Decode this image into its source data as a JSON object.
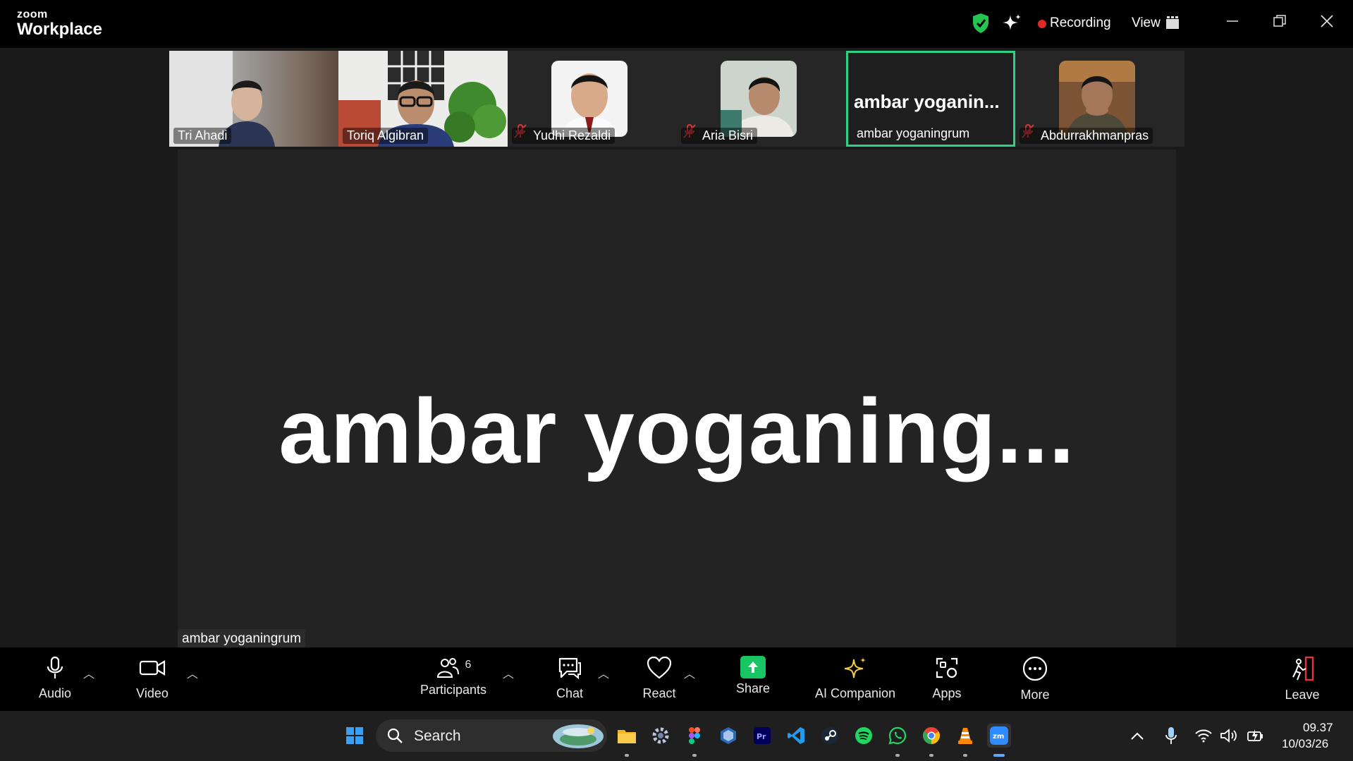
{
  "app": {
    "brand_small": "zoom",
    "brand_big": "Workplace"
  },
  "header": {
    "recording_label": "Recording",
    "view_label": "View"
  },
  "thumbnails": [
    {
      "name": "Tri Ahadi",
      "muted": false
    },
    {
      "name": "Toriq Algibran",
      "muted": false
    },
    {
      "name": "Yudhi Rezaldi",
      "muted": true
    },
    {
      "name": "Aria Bisri",
      "muted": true
    },
    {
      "name": "ambar yoganingrum",
      "muted": false,
      "display": "ambar  yoganin..."
    },
    {
      "name": "Abdurrakhmanpras",
      "muted": true
    }
  ],
  "stage": {
    "display_name": "ambar yoganing...",
    "label": "ambar yoganingrum"
  },
  "toolbar": {
    "audio": "Audio",
    "video": "Video",
    "participants": "Participants",
    "participants_count": "6",
    "chat": "Chat",
    "react": "React",
    "share": "Share",
    "ai_companion": "AI Companion",
    "apps": "Apps",
    "more": "More",
    "leave": "Leave"
  },
  "taskbar": {
    "search_label": "Search",
    "time": "09.37",
    "date": "10/03/26"
  },
  "colors": {
    "active_speaker": "#2fd285",
    "share": "#19c463",
    "recording": "#e02828",
    "leave": "#e0353d"
  }
}
